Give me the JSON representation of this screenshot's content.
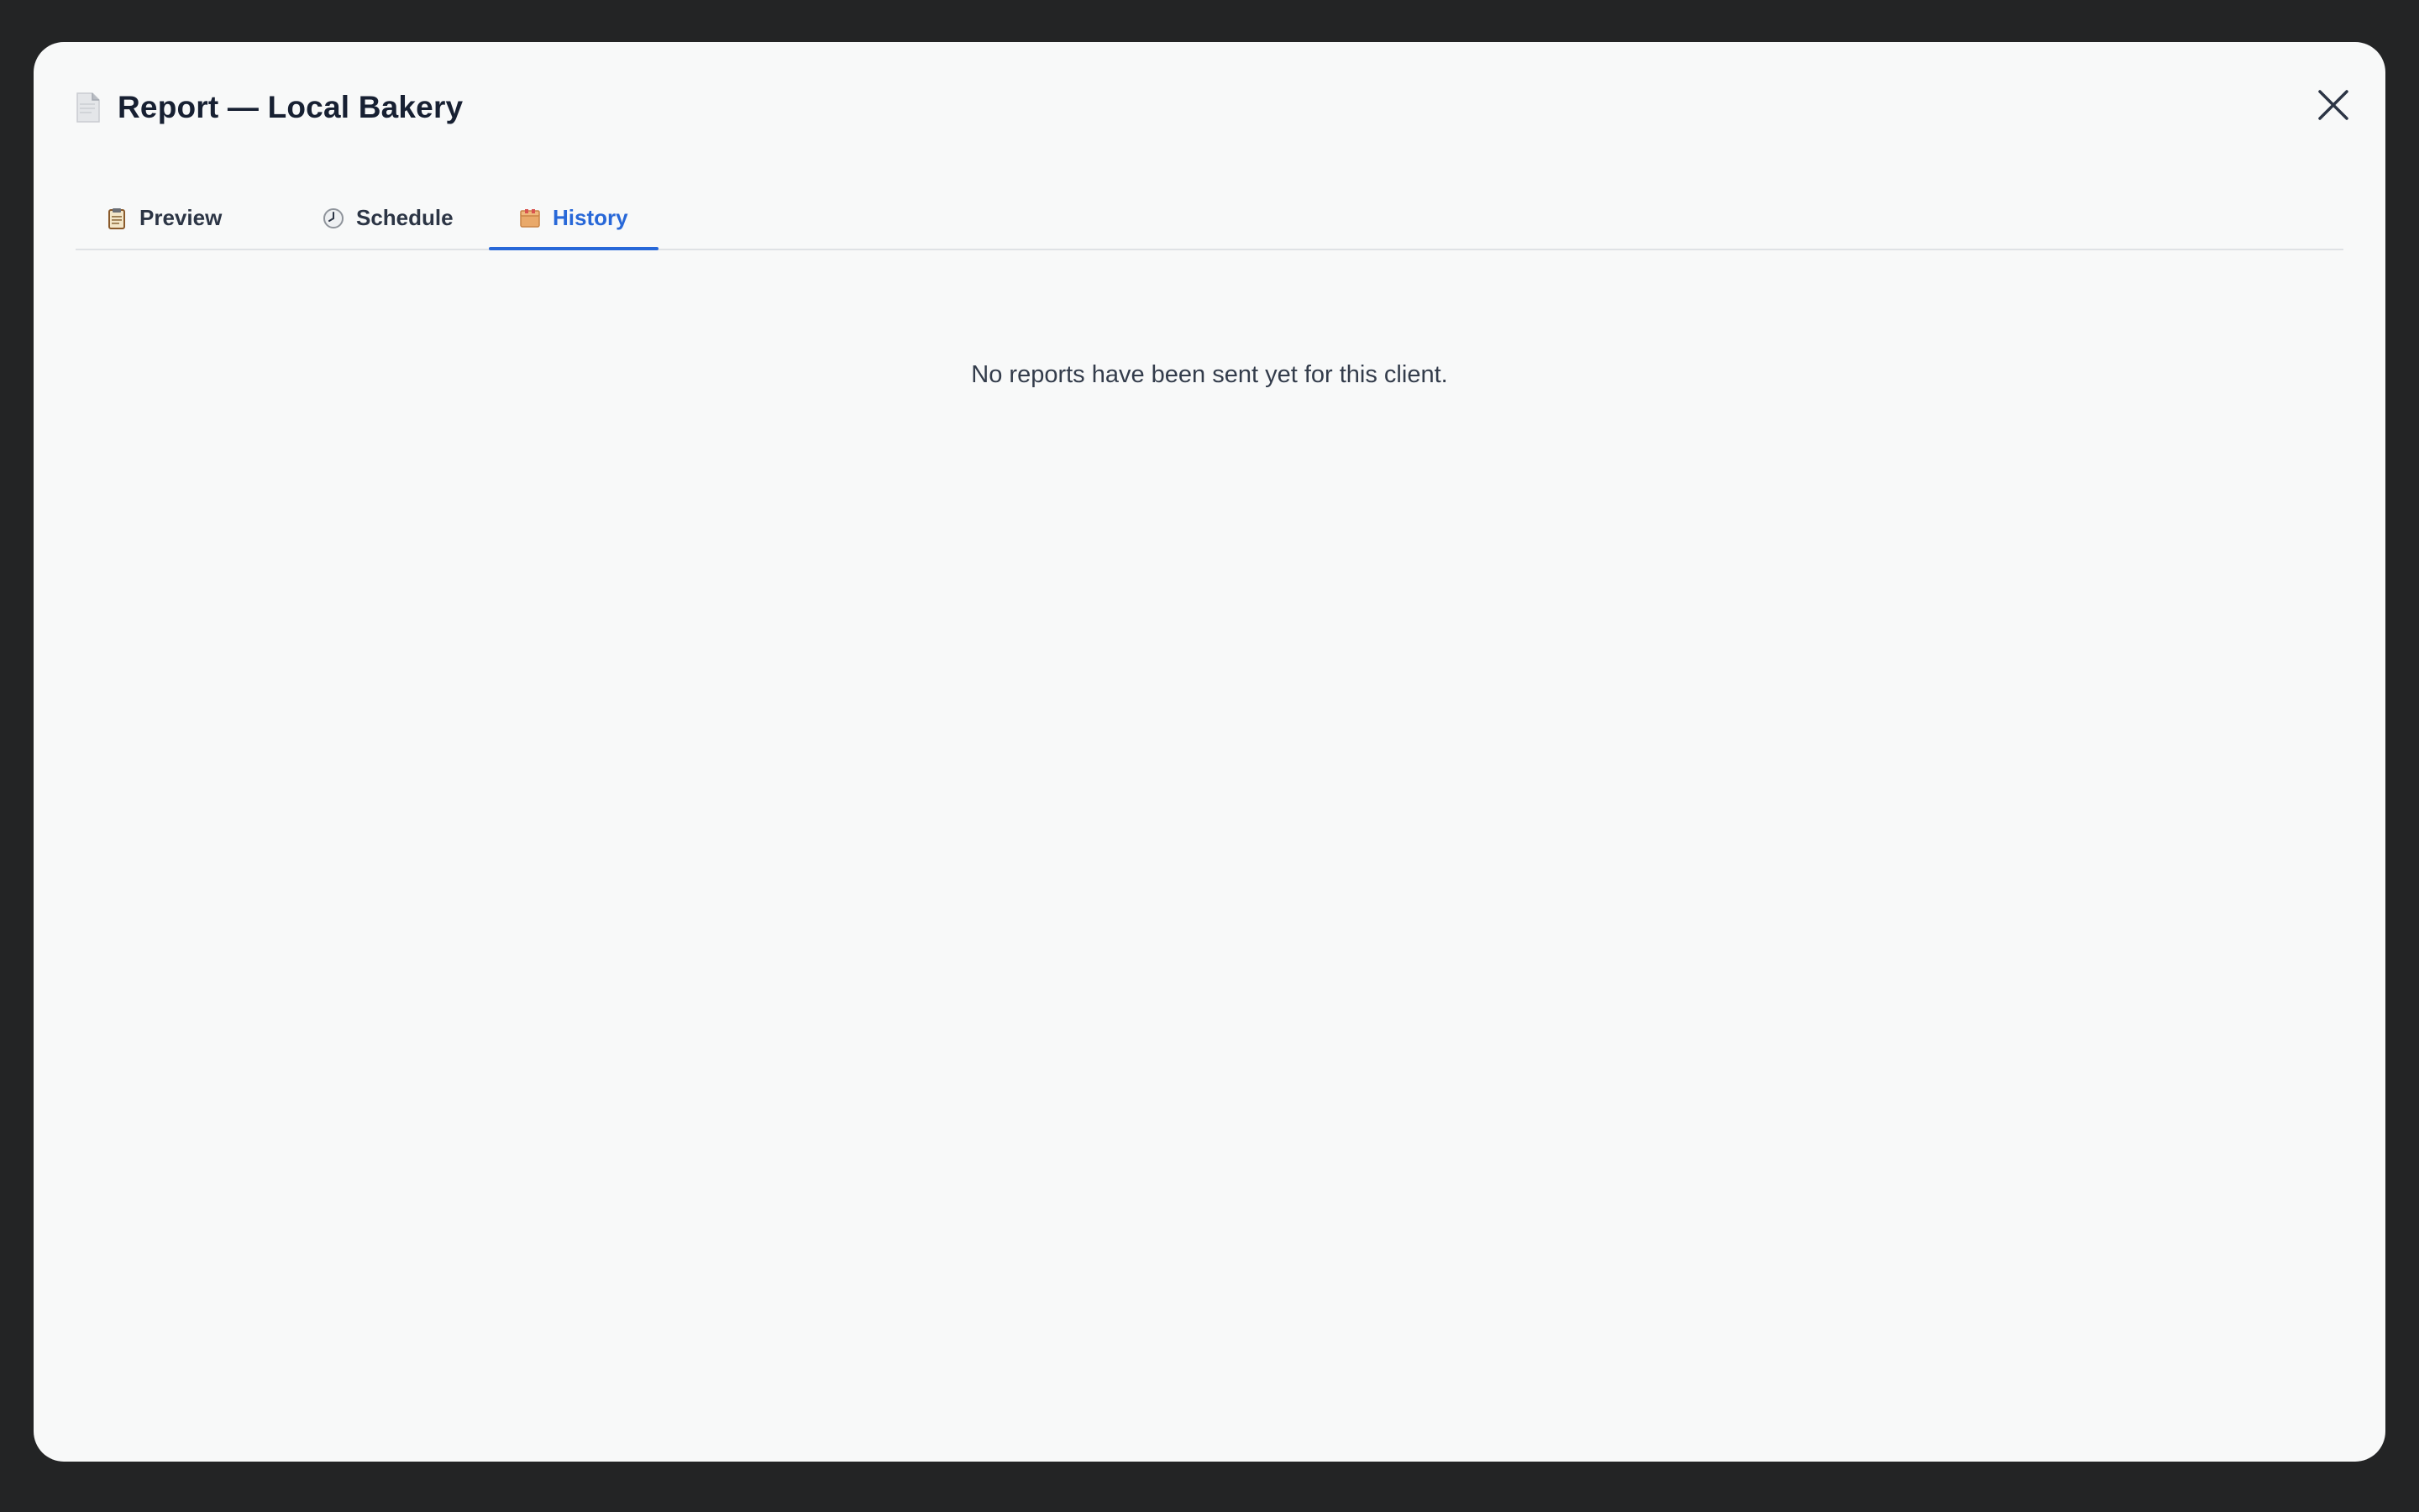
{
  "modal": {
    "title": "Report — Local Bakery",
    "title_icon": "document-icon",
    "close_icon": "close-icon"
  },
  "tabs": [
    {
      "label": "Preview",
      "icon": "clipboard-icon",
      "active": false
    },
    {
      "label": "Schedule",
      "icon": "clock-icon",
      "active": false
    },
    {
      "label": "History",
      "icon": "archive-box-icon",
      "active": true
    }
  ],
  "history": {
    "empty_message": "No reports have been sent yet for this client."
  },
  "colors": {
    "accent": "#2868d8",
    "title_text": "#172032",
    "body_text": "#333c4b",
    "modal_bg": "#f8f9f9",
    "backdrop": "#232425"
  }
}
